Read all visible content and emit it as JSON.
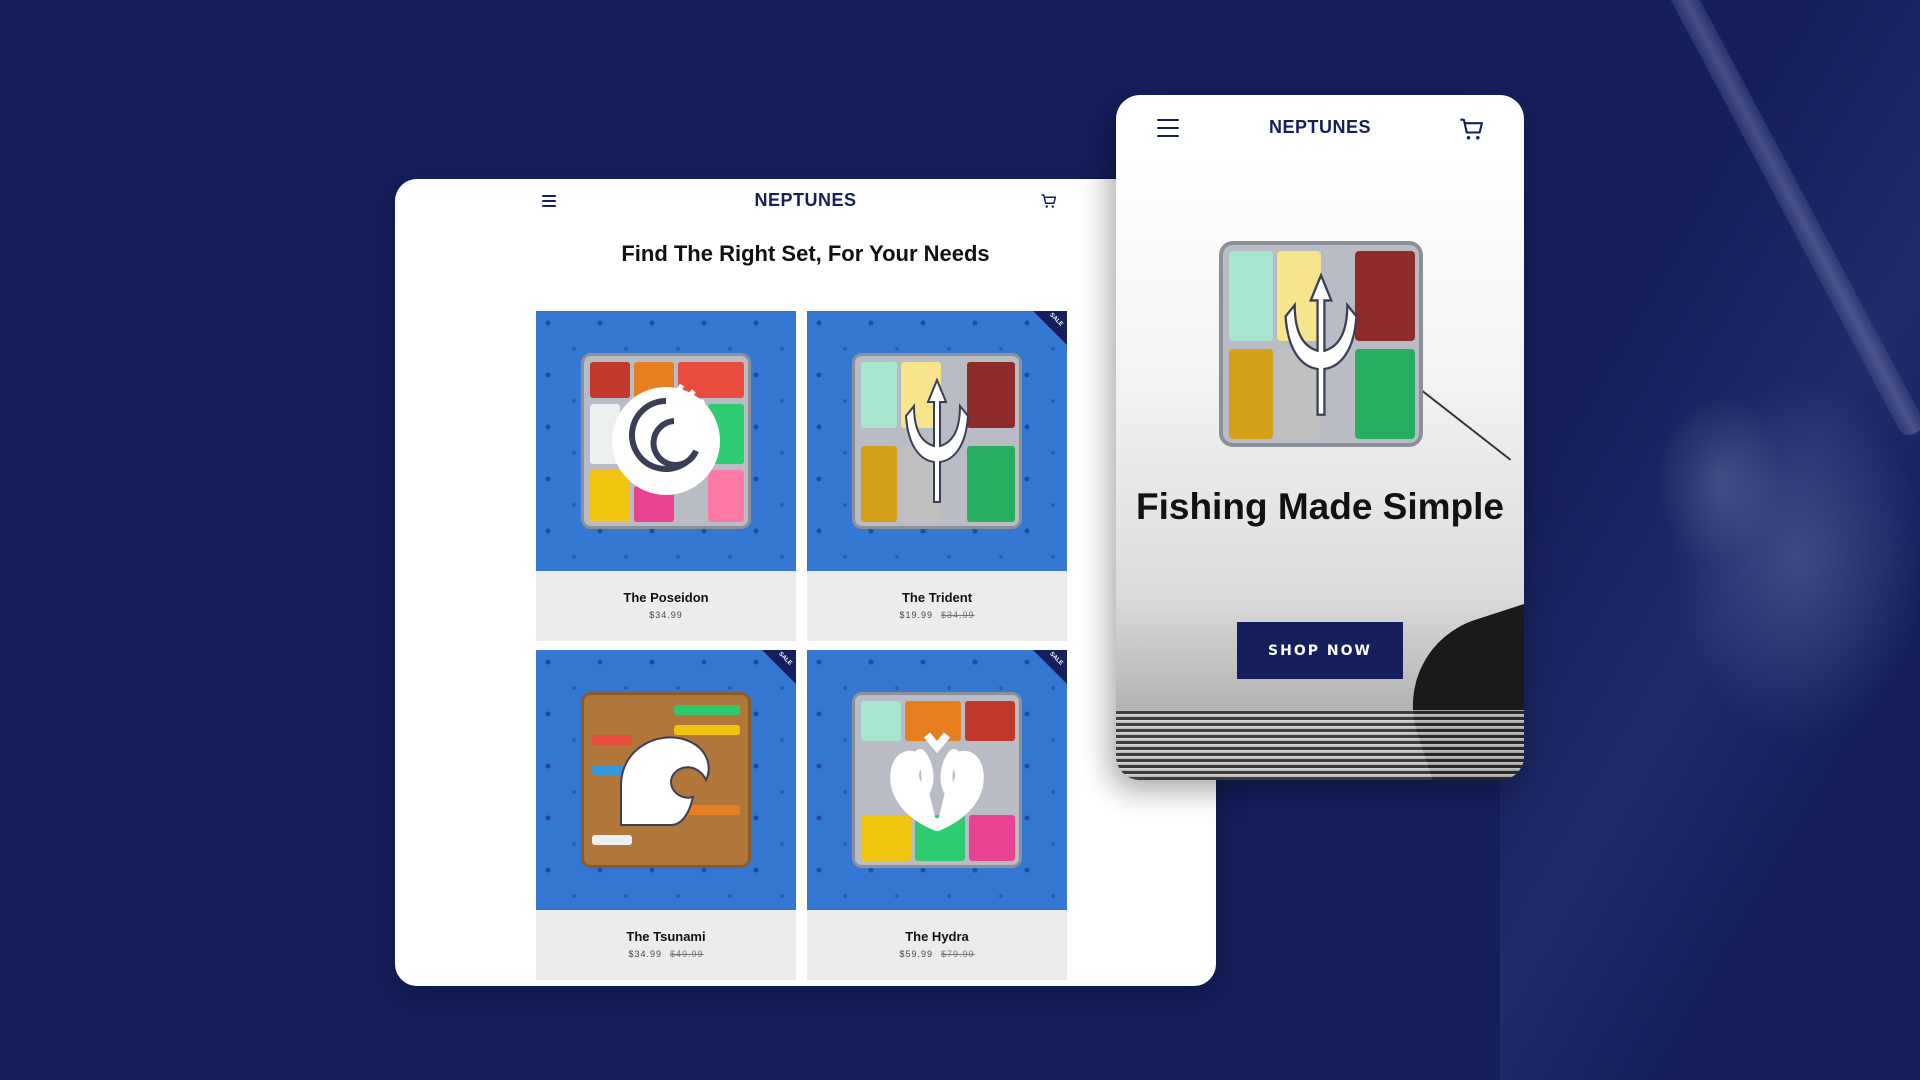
{
  "desktop": {
    "brand": "NEPTUNES",
    "heading": "Find The Right Set, For Your Needs",
    "products": [
      {
        "name": "The Poseidon",
        "price": "$34.99",
        "old_price": "",
        "sale": false,
        "badge": ""
      },
      {
        "name": "The Trident",
        "price": "$19.99",
        "old_price": "$34.99",
        "sale": true,
        "badge": "SALE"
      },
      {
        "name": "The Tsunami",
        "price": "$34.99",
        "old_price": "$49.99",
        "sale": true,
        "badge": "SALE"
      },
      {
        "name": "The Hydra",
        "price": "$59.99",
        "old_price": "$79.99",
        "sale": true,
        "badge": "SALE"
      }
    ]
  },
  "mobile": {
    "brand": "NEPTUNES",
    "hero_title": "Fishing Made Simple",
    "cta_label": "SHOP NOW"
  },
  "colors": {
    "background": "#141f5c",
    "brand": "#141f5c",
    "product_bg": "#3578d4",
    "card_footer": "#ececec"
  },
  "icons": [
    "menu-icon",
    "cart-icon",
    "anchor-pattern",
    "poseidon-logo",
    "trident-logo",
    "wave-logo",
    "hydra-logo"
  ]
}
